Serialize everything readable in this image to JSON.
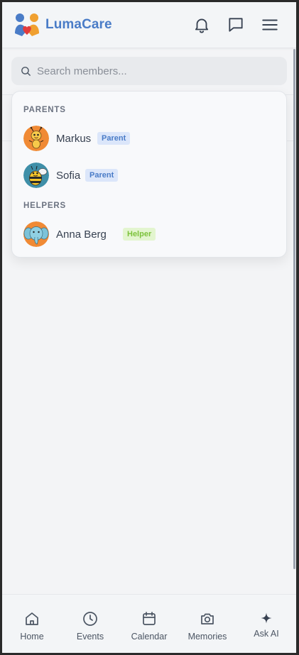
{
  "app": {
    "brand": "LumaCare"
  },
  "search": {
    "placeholder": "Search members..."
  },
  "dropdown": {
    "sections": [
      {
        "title": "PARENTS",
        "members": [
          {
            "name": "Markus",
            "badge": "Parent",
            "avatar": "ant-avatar"
          },
          {
            "name": "Sofia",
            "badge": "Parent",
            "avatar": "bee-avatar"
          }
        ]
      },
      {
        "title": "HELPERS",
        "members": [
          {
            "name": "Anna Berg",
            "badge": "Helper",
            "avatar": "elephant-avatar"
          }
        ]
      }
    ]
  },
  "nav": {
    "items": [
      {
        "label": "Home",
        "icon": "home-icon"
      },
      {
        "label": "Events",
        "icon": "clock-icon"
      },
      {
        "label": "Calendar",
        "icon": "calendar-icon"
      },
      {
        "label": "Memories",
        "icon": "camera-icon"
      },
      {
        "label": "Ask AI",
        "icon": "sparkle-icon"
      }
    ]
  },
  "colors": {
    "brand": "#4a7cc7",
    "parent_badge_bg": "#dbe6fa",
    "helper_badge_bg": "#e3f5cf",
    "helper_badge_text": "#7cc23b"
  }
}
